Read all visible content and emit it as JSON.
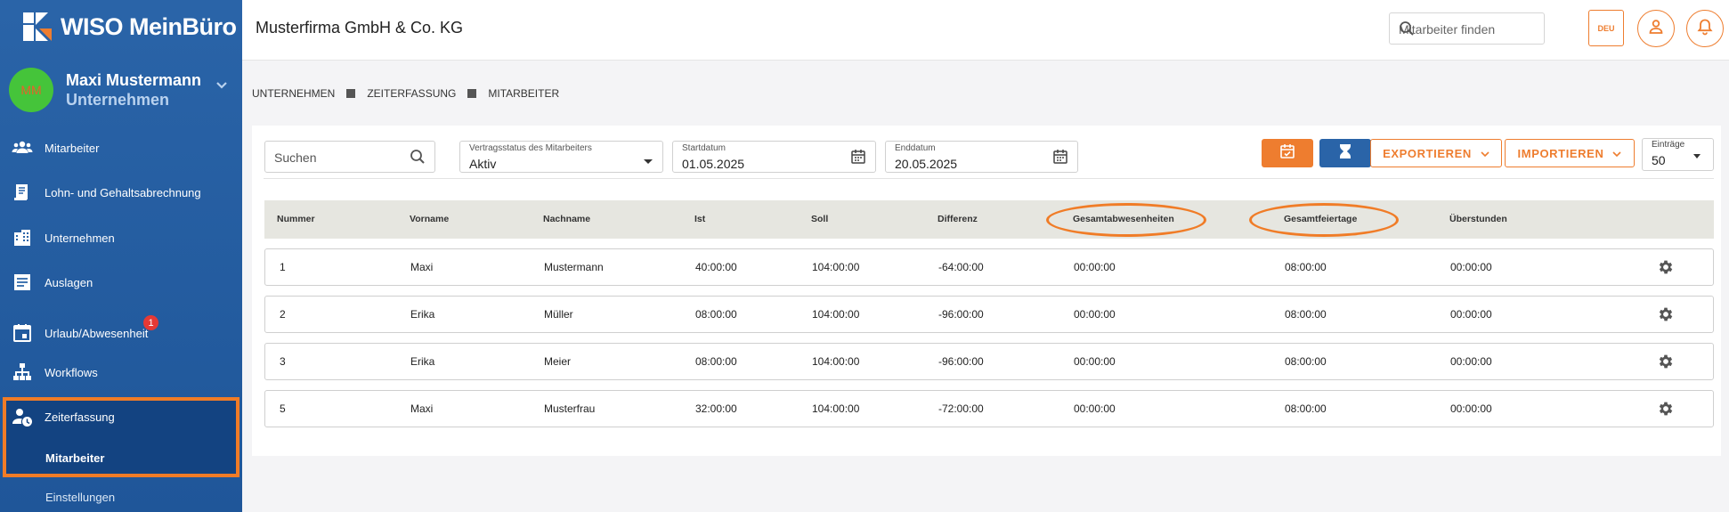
{
  "app": {
    "logo_text": "WISO MeinBüro"
  },
  "user": {
    "initials": "MM",
    "name": "Maxi Mustermann",
    "role": "Unternehmen"
  },
  "sidebar": {
    "items": [
      {
        "label": "Mitarbeiter",
        "icon": "people-icon"
      },
      {
        "label": "Lohn- und Gehaltsabrechnung",
        "icon": "document-icon"
      },
      {
        "label": "Unternehmen",
        "icon": "building-icon"
      },
      {
        "label": "Auslagen",
        "icon": "receipt-icon"
      },
      {
        "label": "Urlaub/Abwesenheit",
        "icon": "calendar-icon",
        "badge": "1"
      },
      {
        "label": "Workflows",
        "icon": "workflow-icon"
      },
      {
        "label": "Zeiterfassung",
        "icon": "person-clock-icon"
      }
    ],
    "sub_items": [
      "Mitarbeiter",
      "Einstellungen"
    ]
  },
  "header": {
    "company": "Musterfirma GmbH & Co. KG",
    "search_placeholder": "Mitarbeiter finden",
    "lang": "DEU"
  },
  "breadcrumb": [
    "UNTERNEHMEN",
    "ZEITERFASSUNG",
    "MITARBEITER"
  ],
  "filters": {
    "search_placeholder": "Suchen",
    "status_label": "Vertragsstatus des Mitarbeiters",
    "status_value": "Aktiv",
    "start_label": "Startdatum",
    "start_value": "01.05.2025",
    "end_label": "Enddatum",
    "end_value": "20.05.2025",
    "export_label": "EXPORTIEREN",
    "import_label": "IMPORTIEREN",
    "entries_label": "Einträge",
    "entries_value": "50"
  },
  "table": {
    "headers": [
      "Nummer",
      "Vorname",
      "Nachname",
      "Ist",
      "Soll",
      "Differenz",
      "Gesamtabwesenheiten",
      "Gesamtfeiertage",
      "Überstunden"
    ],
    "rows": [
      [
        "1",
        "Maxi",
        "Mustermann",
        "40:00:00",
        "104:00:00",
        "-64:00:00",
        "00:00:00",
        "08:00:00",
        "00:00:00"
      ],
      [
        "2",
        "Erika",
        "Müller",
        "08:00:00",
        "104:00:00",
        "-96:00:00",
        "00:00:00",
        "08:00:00",
        "00:00:00"
      ],
      [
        "3",
        "Erika",
        "Meier",
        "08:00:00",
        "104:00:00",
        "-96:00:00",
        "00:00:00",
        "08:00:00",
        "00:00:00"
      ],
      [
        "5",
        "Maxi",
        "Musterfrau",
        "32:00:00",
        "104:00:00",
        "-72:00:00",
        "00:00:00",
        "08:00:00",
        "00:00:00"
      ]
    ]
  },
  "colors": {
    "sidebar": "#2a64a8",
    "accent": "#ee7d2f",
    "secondary_button": "#2a64a8",
    "highlight": "#f07c27"
  }
}
